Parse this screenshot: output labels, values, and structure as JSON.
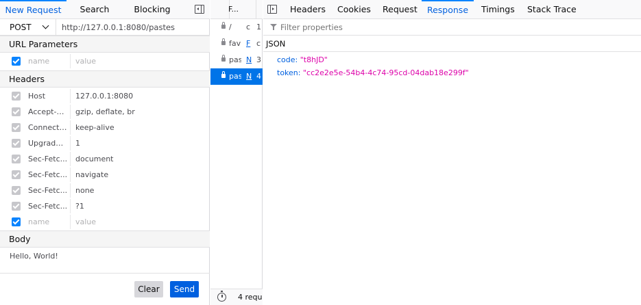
{
  "left_tabs": [
    "New Request",
    "Search",
    "Blocking"
  ],
  "request": {
    "method": "POST",
    "url": "http://127.0.0.1:8080/pastes"
  },
  "url_params": {
    "title": "URL Parameters",
    "placeholder_name": "name",
    "placeholder_value": "value"
  },
  "headers": {
    "title": "Headers",
    "rows": [
      {
        "name": "Host",
        "value": "127.0.0.1:8080"
      },
      {
        "name": "Accept-E...",
        "value": "gzip, deflate, br"
      },
      {
        "name": "Connecti...",
        "value": "keep-alive"
      },
      {
        "name": "Upgrade-...",
        "value": "1"
      },
      {
        "name": "Sec-Fetc...",
        "value": "document"
      },
      {
        "name": "Sec-Fetc...",
        "value": "navigate"
      },
      {
        "name": "Sec-Fetc...",
        "value": "none"
      },
      {
        "name": "Sec-Fetc...",
        "value": "?1"
      }
    ],
    "placeholder_name": "name",
    "placeholder_value": "value"
  },
  "body": {
    "title": "Body",
    "text": "Hello, World!"
  },
  "buttons": {
    "clear": "Clear",
    "send": "Send"
  },
  "list": {
    "header_file": "F...",
    "rows": [
      {
        "file": "/",
        "domain": "c",
        "status": "1",
        "selected": false
      },
      {
        "file": "favi",
        "domain": "F",
        "status": "c",
        "selected": false
      },
      {
        "file": "past",
        "domain": "N",
        "status": "3",
        "selected": false
      },
      {
        "file": "past",
        "domain": "N",
        "status": "4",
        "selected": true
      }
    ],
    "footer": "4 requ"
  },
  "right_tabs": [
    "Headers",
    "Cookies",
    "Request",
    "Response",
    "Timings",
    "Stack Trace"
  ],
  "active_right_tab": "Response",
  "filter_placeholder": "Filter properties",
  "json_title": "JSON",
  "json": [
    {
      "key": "code:",
      "value": "\"t8hJD\""
    },
    {
      "key": "token:",
      "value": "\"cc2e2e5e-54b4-4c74-95cd-04dab18e299f\""
    }
  ],
  "colors": {
    "accent": "#0060df",
    "selection": "#0074e8",
    "json_string": "#dd00a9"
  }
}
